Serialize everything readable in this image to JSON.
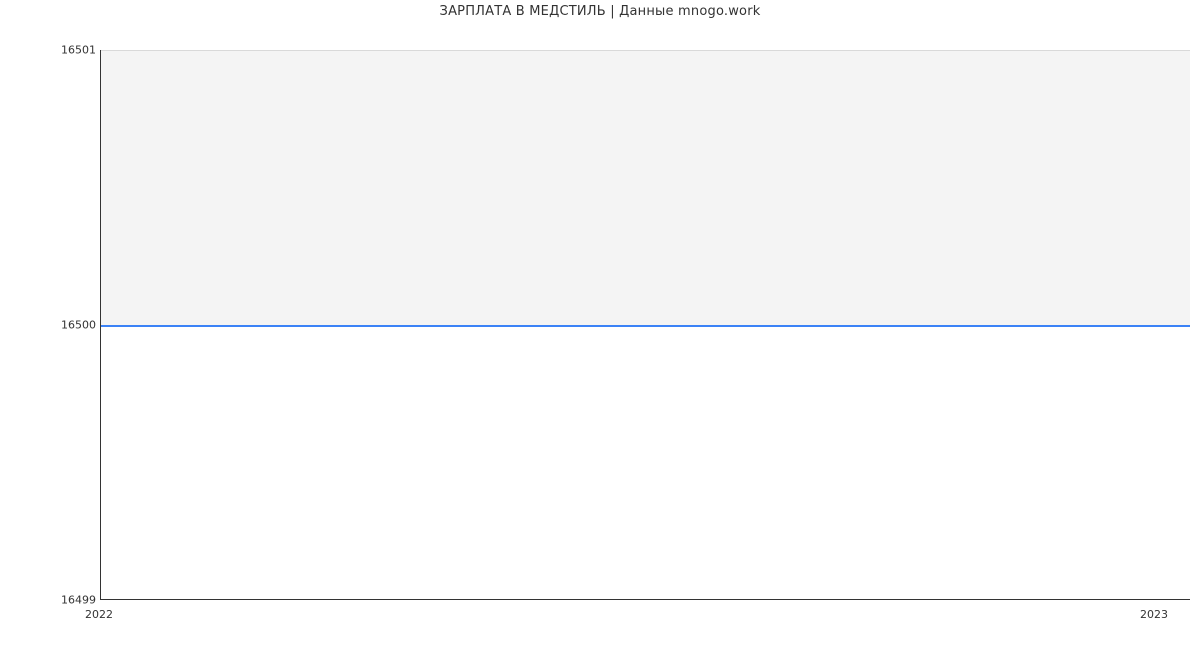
{
  "chart_data": {
    "type": "area",
    "title": "ЗАРПЛАТА В МЕДСТИЛЬ | Данные mnogo.work",
    "xlabel": "",
    "ylabel": "",
    "x_ticks": [
      "2022",
      "2023"
    ],
    "y_ticks": [
      "16499",
      "16500",
      "16501"
    ],
    "ylim": [
      16499,
      16501
    ],
    "x": [
      "2022",
      "2023"
    ],
    "values": [
      16500,
      16500
    ],
    "series_color": "#3b82f6",
    "fill_color": "#f4f4f4"
  }
}
